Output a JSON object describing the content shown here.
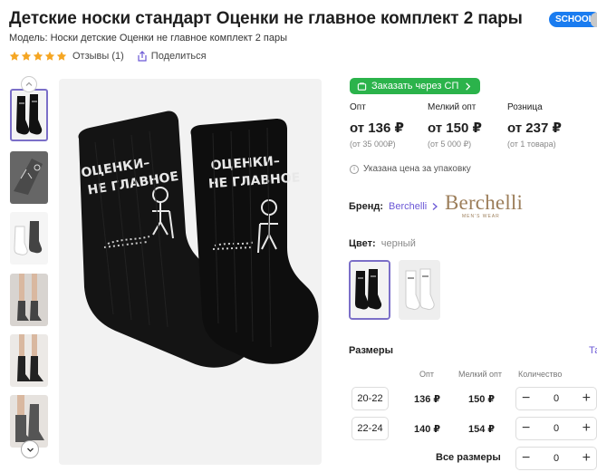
{
  "product": {
    "title": "Детские носки стандарт Оценки не главное комплект 2 пары",
    "badge": "SCHOOL",
    "model": "Модель: Носки детские Оценки не главное комплект 2 пары",
    "rating_stars": 5,
    "reviews": "Отзывы (1)",
    "share": "Поделиться"
  },
  "gallery": {
    "thumbnails": [
      "black-socks",
      "grey-socks",
      "white-and-grey-socks",
      "socks-worn-1",
      "socks-worn-2",
      "socks-worn-3"
    ],
    "selected_index": 0,
    "sock_print": [
      "ОЦЕНКИ–",
      "НЕ ГЛАВНОЕ"
    ]
  },
  "order": {
    "button_label": "Заказать через СП"
  },
  "prices": [
    {
      "label": "Опт",
      "value": "от 136 ₽",
      "note": "(от 35 000₽)"
    },
    {
      "label": "Мелкий опт",
      "value": "от 150 ₽",
      "note": "(от 5 000 ₽)"
    },
    {
      "label": "Розница",
      "value": "от 237 ₽",
      "note": "(от 1 товара)"
    }
  ],
  "price_info": "Указана цена за упаковку",
  "brand": {
    "label": "Бренд:",
    "name": "Berchelli",
    "logo_text": "Berchelli",
    "logo_sub": "MEN'S WEAR"
  },
  "color": {
    "label": "Цвет:",
    "value": "черный",
    "swatches": [
      "black",
      "white"
    ],
    "selected_index": 0
  },
  "sizes": {
    "title": "Размеры",
    "tab_partial": "Та",
    "headers": {
      "opt": "Опт",
      "small_opt": "Мелкий опт",
      "qty": "Количество"
    },
    "rows": [
      {
        "size": "20-22",
        "opt": "136 ₽",
        "small_opt": "150 ₽",
        "qty": "0"
      },
      {
        "size": "22-24",
        "opt": "140 ₽",
        "small_opt": "154 ₽",
        "qty": "0"
      }
    ],
    "all_label": "Все размеры",
    "all_qty": "0"
  },
  "colors": {
    "accent": "#6b58d6",
    "order_green": "#2bb34b",
    "badge_blue": "#1a7cf0",
    "star": "#f5a623",
    "brand_gold": "#9c7e5a"
  }
}
